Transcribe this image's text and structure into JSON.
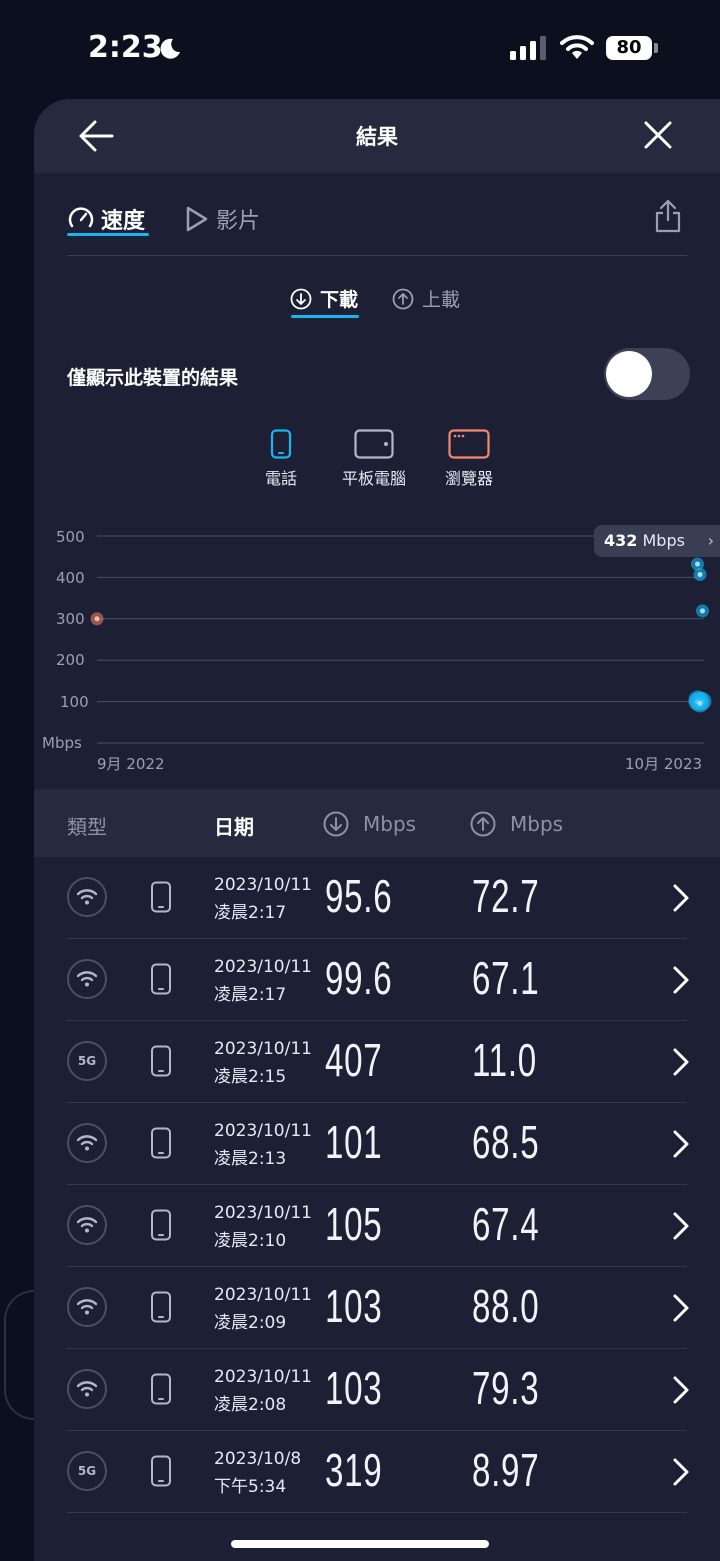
{
  "status": {
    "time": "2:23",
    "battery": "80"
  },
  "header": {
    "title": "結果"
  },
  "tabs": {
    "speed": "速度",
    "video": "影片"
  },
  "subtabs": {
    "download": "下載",
    "upload": "上載"
  },
  "toggle": {
    "label": "僅顯示此裝置的結果",
    "on": false
  },
  "devices": {
    "phone": "電話",
    "tablet": "平板電腦",
    "browser": "瀏覽器"
  },
  "colors": {
    "accent": "#18b5f2",
    "browser": "#f08a6a",
    "bg": "#1d2034"
  },
  "chart_data": {
    "type": "scatter",
    "ylabel": "Mbps",
    "y_ticks": [
      "500",
      "400",
      "300",
      "200",
      "100"
    ],
    "ylim": [
      0,
      500
    ],
    "x_start_label": "9月 2022",
    "x_end_label": "10月 2023",
    "grid": true,
    "tooltip": {
      "value": "432",
      "unit": "Mbps"
    },
    "series": [
      {
        "values": [
          {
            "x": "2022-09",
            "y": 300
          }
        ]
      },
      {
        "values": [
          {
            "x": "2023-10",
            "y": 432
          },
          {
            "x": "2023-10",
            "y": 407
          },
          {
            "x": "2023-10",
            "y": 319
          },
          {
            "x": "2023-10",
            "y": 105
          },
          {
            "x": "2023-10",
            "y": 103
          },
          {
            "x": "2023-10",
            "y": 101
          },
          {
            "x": "2023-10",
            "y": 99.6
          },
          {
            "x": "2023-10",
            "y": 95.6
          }
        ]
      }
    ]
  },
  "table": {
    "headers": {
      "type": "類型",
      "date": "日期",
      "down": "Mbps",
      "up": "Mbps"
    },
    "rows": [
      {
        "net": "wifi",
        "date": "2023/10/11",
        "time": "凌晨2:17",
        "down": "95.6",
        "up": "72.7"
      },
      {
        "net": "wifi",
        "date": "2023/10/11",
        "time": "凌晨2:17",
        "down": "99.6",
        "up": "67.1"
      },
      {
        "net": "5G",
        "date": "2023/10/11",
        "time": "凌晨2:15",
        "down": "407",
        "up": "11.0"
      },
      {
        "net": "wifi",
        "date": "2023/10/11",
        "time": "凌晨2:13",
        "down": "101",
        "up": "68.5"
      },
      {
        "net": "wifi",
        "date": "2023/10/11",
        "time": "凌晨2:10",
        "down": "105",
        "up": "67.4"
      },
      {
        "net": "wifi",
        "date": "2023/10/11",
        "time": "凌晨2:09",
        "down": "103",
        "up": "88.0"
      },
      {
        "net": "wifi",
        "date": "2023/10/11",
        "time": "凌晨2:08",
        "down": "103",
        "up": "79.3"
      },
      {
        "net": "5G",
        "date": "2023/10/8",
        "time": "下午5:34",
        "down": "319",
        "up": "8.97"
      }
    ]
  }
}
